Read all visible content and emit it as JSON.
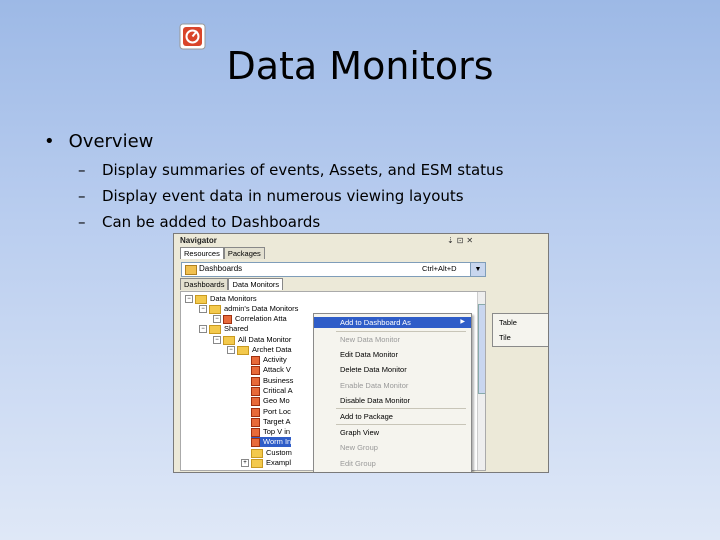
{
  "slide": {
    "title": "Data Monitors",
    "bullet": "Overview",
    "sub_bullets": [
      "Display summaries of events, Assets, and ESM status",
      "Display event data in numerous viewing layouts",
      "Can be added to Dashboards"
    ],
    "bullet_marker": "•",
    "dash_marker": "–",
    "logo_icon": "product-logo-icon"
  },
  "navigator": {
    "title": "Navigator",
    "window_controls": [
      "⇣",
      "⊡",
      "✕"
    ],
    "tabs": [
      "Resources",
      "Packages"
    ],
    "combo_value": "Dashboards",
    "combo_shortcut": "Ctrl+Alt+D",
    "sub_tabs": [
      "Dashboards",
      "Data Monitors"
    ]
  },
  "tree": {
    "items": [
      {
        "label": "Data Monitors",
        "type": "folder"
      },
      {
        "label": "admin's Data Monitors",
        "type": "folder"
      },
      {
        "label": "Correlation Atta",
        "type": "monitor"
      },
      {
        "label": "Shared",
        "type": "folder"
      },
      {
        "label": "All Data Monitor",
        "type": "folder"
      },
      {
        "label": "Archet Data",
        "type": "folder"
      },
      {
        "label": "Activity",
        "type": "monitor"
      },
      {
        "label": "Attack V",
        "type": "monitor"
      },
      {
        "label": "Business",
        "type": "monitor"
      },
      {
        "label": "Critical A",
        "type": "monitor"
      },
      {
        "label": "Geo Mo",
        "type": "monitor"
      },
      {
        "label": "Port Loc",
        "type": "monitor"
      },
      {
        "label": "Target A",
        "type": "monitor"
      },
      {
        "label": "Top V in",
        "type": "monitor"
      },
      {
        "label": "Worm In",
        "type": "monitor"
      },
      {
        "label": "Custom",
        "type": "folder"
      },
      {
        "label": "Exampl",
        "type": "folder"
      }
    ]
  },
  "context_menu": {
    "items": [
      {
        "label": "Add to Dashboard As",
        "state": "highlighted"
      },
      {
        "label": "New Data Monitor",
        "state": "disabled"
      },
      {
        "label": "Edit Data Monitor",
        "state": "enabled"
      },
      {
        "label": "Delete Data Monitor",
        "state": "enabled"
      },
      {
        "label": "Enable Data Monitor",
        "state": "disabled"
      },
      {
        "label": "Disable Data Monitor",
        "state": "enabled"
      },
      {
        "label": "Add to Package",
        "state": "enabled"
      },
      {
        "label": "Graph View",
        "state": "enabled"
      },
      {
        "label": "New Group",
        "state": "disabled"
      },
      {
        "label": "Edit Group",
        "state": "disabled"
      }
    ],
    "submenu": [
      "Table",
      "Tile"
    ],
    "submenu_arrow": "▶"
  },
  "colors": {
    "highlight": "#2f5dc8",
    "folder": "#f3c94c",
    "monitor": "#e86a3a"
  }
}
